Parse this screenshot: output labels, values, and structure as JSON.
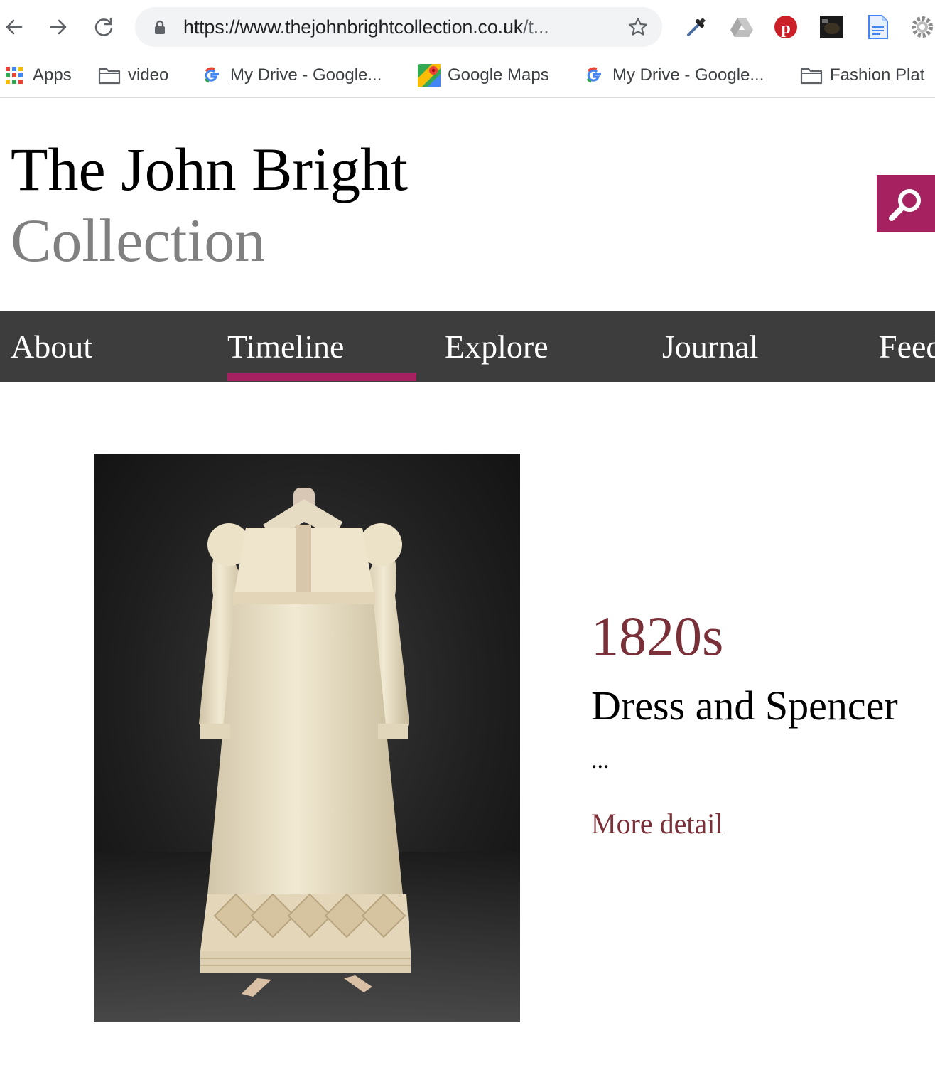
{
  "browser": {
    "url_main": "https://www.thejohnbrightcollection.co.uk",
    "url_rest": "/t...",
    "extensions": [
      "eyedropper-icon",
      "google-drive-icon",
      "pinterest-icon",
      "photo-extension-icon",
      "docs-icon",
      "settings-gear-icon"
    ]
  },
  "bookmarks": [
    {
      "label": "Apps",
      "icon": "apps-grid-icon"
    },
    {
      "label": "video",
      "icon": "folder-icon"
    },
    {
      "label": "My Drive - Google...",
      "icon": "google-g-icon"
    },
    {
      "label": "Google Maps",
      "icon": "google-maps-icon"
    },
    {
      "label": "My Drive - Google...",
      "icon": "google-g-icon"
    },
    {
      "label": "Fashion Plat",
      "icon": "folder-icon"
    }
  ],
  "site": {
    "title_line1": "The John Bright",
    "title_line2": "Collection",
    "accent_color": "#a6215f"
  },
  "nav": {
    "items": [
      "About",
      "Timeline",
      "Explore",
      "Journal",
      "Feed"
    ],
    "active": "Timeline"
  },
  "item": {
    "decade": "1820s",
    "title": "Dress and Spencer",
    "summary": "...",
    "link_label": "More detail",
    "image_subject": "cream dress and spencer on mannequin"
  }
}
